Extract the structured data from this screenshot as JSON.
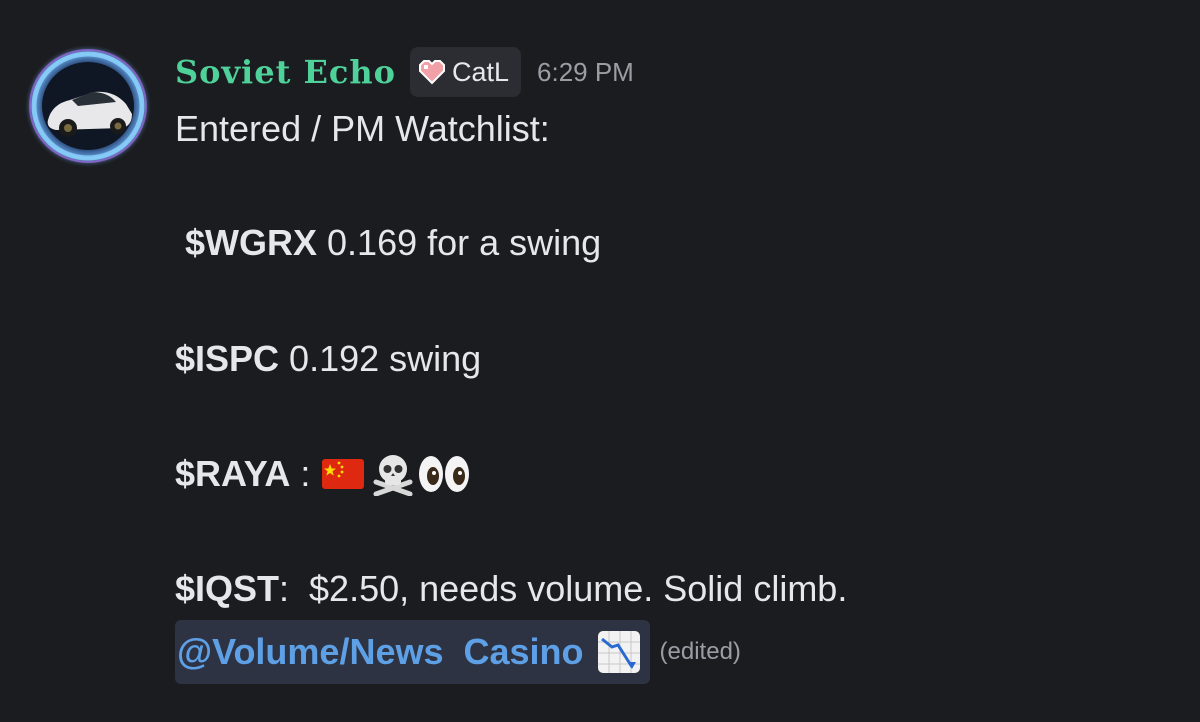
{
  "author": {
    "username": "Soviet Echo",
    "tag": "CatL",
    "tag_icon": "pixel-heart-icon",
    "timestamp": "6:29 PM",
    "avatar": "sports-car-avatar"
  },
  "message": {
    "line1": "Entered / PM Watchlist:",
    "line2_ticker": "$WGRX",
    "line2_text": " 0.169 for a swing",
    "line3_ticker": "$ISPC",
    "line3_text": " 0.192 swing",
    "line4_ticker": "$RAYA",
    "line4_text": " : ",
    "line4_emojis": [
      "china-flag-icon",
      "skull-crossbones-icon",
      "eyes-icon"
    ],
    "line5_ticker": "$IQST",
    "line5_text": ":  $2.50, needs volume. Solid climb.",
    "mention": "@Volume/News  Casino",
    "mention_icon": "chart-decreasing-icon",
    "edited_label": "(edited)"
  },
  "colors": {
    "background": "#1b1c20",
    "username": "#4fd19a",
    "mention_text": "#5ea0e6",
    "mention_bg": "#2e3344"
  }
}
